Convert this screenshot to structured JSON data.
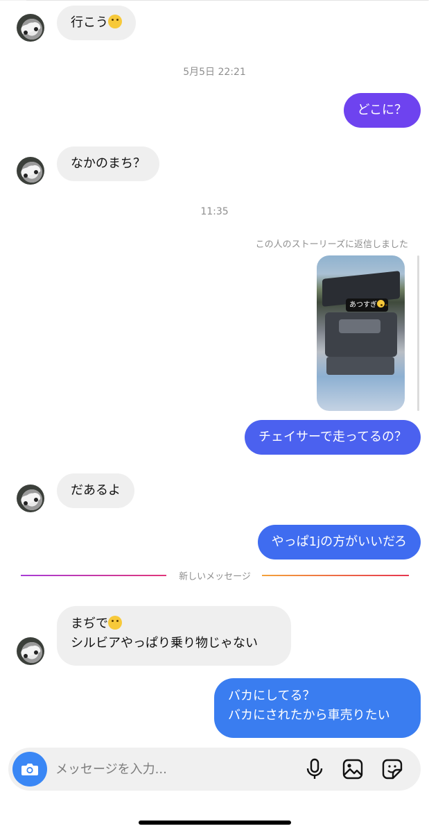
{
  "colors": {
    "received_bubble": "#efefef",
    "sent_top": "#7b3ff2",
    "sent_bottom": "#3a78f0",
    "accent_camera": "#3a87f5"
  },
  "messages": [
    {
      "id": "m1",
      "side": "received",
      "text": "行こう",
      "emoji": "face-with-hand-over-mouth"
    },
    {
      "id": "m2",
      "side": "sent",
      "text": "どこに？"
    },
    {
      "id": "m3",
      "side": "received",
      "text": "なかのまち？"
    },
    {
      "id": "m4",
      "side": "sent",
      "text": "チェイサーで走ってるの？"
    },
    {
      "id": "m5",
      "side": "received",
      "text": "だあるよ"
    },
    {
      "id": "m6",
      "side": "sent",
      "text": "やっぱ1jの方がいいだろ"
    },
    {
      "id": "m7",
      "side": "received",
      "lines": [
        "まぢで",
        "シルビアやっぱり乗り物じゃない"
      ],
      "emoji": "melting-face"
    },
    {
      "id": "m8",
      "side": "sent",
      "lines": [
        "バカにしてる？",
        "バカにされたから車売りたい"
      ]
    }
  ],
  "timestamps": {
    "t1": "5月5日 22:21",
    "t2": "11:35"
  },
  "story_reply": {
    "note": "この人のストーリーズに返信しました",
    "sticker_text": "あつすぎ",
    "sticker_emoji": "melting-face"
  },
  "new_messages_divider": "新しいメッセージ",
  "composer": {
    "placeholder": "メッセージを入力...",
    "icons": [
      "camera-icon",
      "microphone-icon",
      "image-icon",
      "sticker-icon"
    ]
  }
}
